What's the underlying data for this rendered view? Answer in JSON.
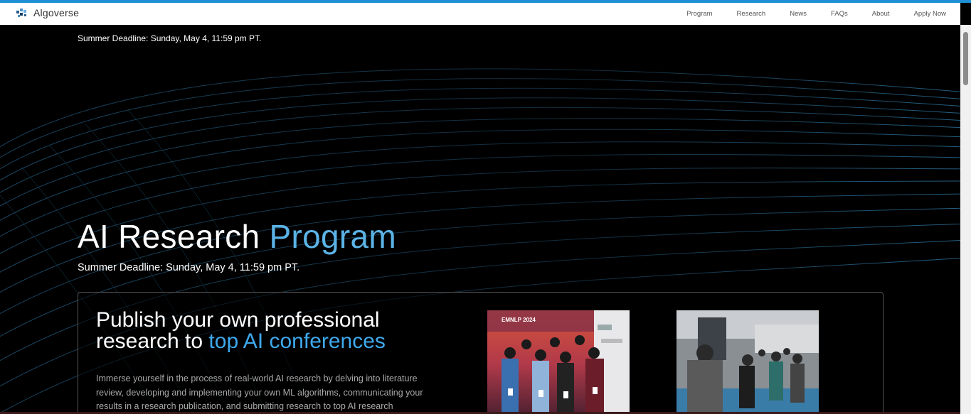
{
  "navbar": {
    "brand": "Algoverse",
    "links": [
      "Program",
      "Research",
      "News",
      "FAQs",
      "About",
      "Apply Now"
    ]
  },
  "hero": {
    "deadline_top": "Summer Deadline: Sunday, May 4, 11:59 pm PT.",
    "title_part1": "AI Research",
    "title_part2": "Program",
    "deadline_main": "Summer Deadline: Sunday, May 4, 11:59 pm PT."
  },
  "card": {
    "title_line1": "Publish your own professional",
    "title_line2_plain": "research to",
    "title_line2_accent": "top AI conferences",
    "text": "Immerse yourself in the process of real-world AI research by delving into literature review, developing and implementing your own ML algorithms, communicating your results in a research publication, and submitting research to top AI research",
    "photo1_caption": "EMNLP 2024"
  },
  "colors": {
    "accent_bar": "#1f8fd6",
    "title_accent": "#5bb3e6",
    "card_accent": "#3ea9ec"
  }
}
